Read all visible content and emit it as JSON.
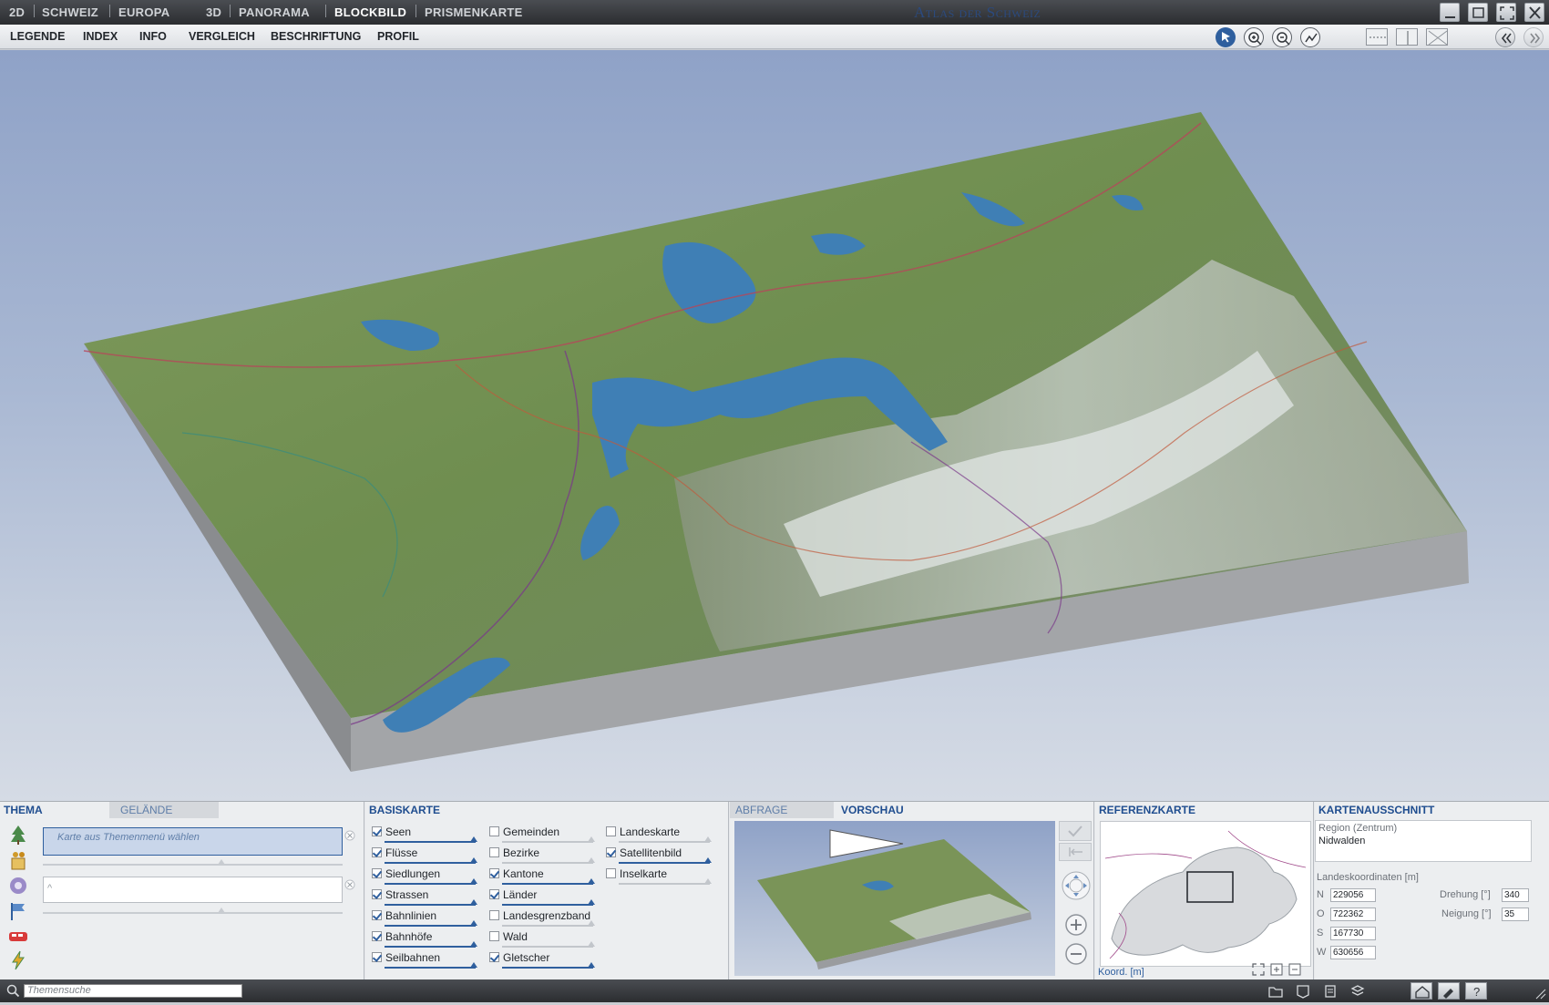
{
  "titlebar": {
    "modes": [
      "2D",
      "SCHWEIZ",
      "EUROPA",
      "3D",
      "PANORAMA",
      "BLOCKBILD",
      "PRISMENKARTE"
    ],
    "active_mode": "BLOCKBILD",
    "app_title": "Atlas der Schweiz"
  },
  "menu": [
    "LEGENDE",
    "INDEX",
    "INFO",
    "VERGLEICH",
    "BESCHRIFTUNG",
    "PROFIL"
  ],
  "thema": {
    "tabs": [
      "THEMA",
      "GELÄNDE"
    ],
    "field_placeholder": "Karte aus Themenmenü wählen",
    "second_field": "^"
  },
  "basiskarte": {
    "title": "BASISKARTE",
    "col1": [
      {
        "label": "Seen",
        "checked": true
      },
      {
        "label": "Flüsse",
        "checked": true
      },
      {
        "label": "Siedlungen",
        "checked": true
      },
      {
        "label": "Strassen",
        "checked": true
      },
      {
        "label": "Bahnlinien",
        "checked": true
      },
      {
        "label": "Bahnhöfe",
        "checked": true
      },
      {
        "label": "Seilbahnen",
        "checked": true
      }
    ],
    "col2": [
      {
        "label": "Gemeinden",
        "checked": false
      },
      {
        "label": "Bezirke",
        "checked": false
      },
      {
        "label": "Kantone",
        "checked": true
      },
      {
        "label": "Länder",
        "checked": true
      },
      {
        "label": "Landesgrenzband",
        "checked": false
      },
      {
        "label": "Wald",
        "checked": false
      },
      {
        "label": "Gletscher",
        "checked": true
      }
    ],
    "col3": [
      {
        "label": "Landeskarte",
        "checked": false
      },
      {
        "label": "Satellitenbild",
        "checked": true
      },
      {
        "label": "Inselkarte",
        "checked": false
      }
    ]
  },
  "vorschau": {
    "tabs": [
      "ABFRAGE",
      "VORSCHAU"
    ]
  },
  "referenzkarte": {
    "title": "REFERENZKARTE",
    "footer": "Koord. [m]"
  },
  "kartenausschnitt": {
    "title": "KARTENAUSSCHNITT",
    "region_label": "Region (Zentrum)",
    "region_value": "Nidwalden",
    "coords_label": "Landeskoordinaten [m]",
    "coords": [
      {
        "label": "N",
        "value": "229056"
      },
      {
        "label": "O",
        "value": "722362"
      },
      {
        "label": "S",
        "value": "167730"
      },
      {
        "label": "W",
        "value": "630656"
      }
    ],
    "drehung_label": "Drehung [°]",
    "drehung_value": "340",
    "neigung_label": "Neigung [°]",
    "neigung_value": "35"
  },
  "statusbar": {
    "search_placeholder": "Themensuche"
  },
  "colors": {
    "accent": "#2f5f9e",
    "titlebar": "#2b2d30",
    "lake": "#3f7fb5",
    "terrain": "#6f8f52"
  }
}
